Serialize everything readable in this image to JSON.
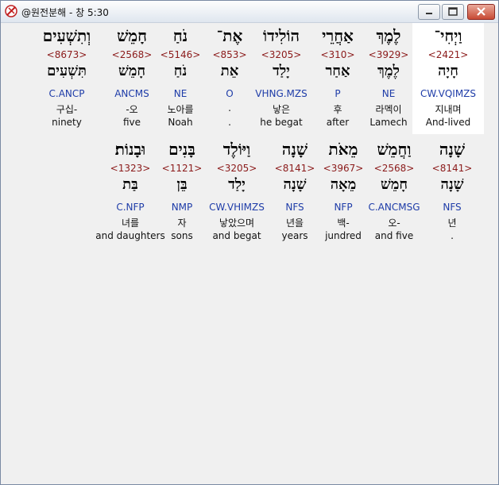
{
  "window": {
    "title": "@원전분해 - 창 5:30",
    "icon": "app-cross-icon"
  },
  "rows": [
    [
      {
        "heb": "וַיְחִי־",
        "strong": "<2421>",
        "lex": "חָיָה",
        "parse": "CW.VQIMZS",
        "kor": "지내며",
        "eng": "And-lived",
        "highlight": true
      },
      {
        "heb": "לֶמֶךְ",
        "strong": "<3929>",
        "lex": "לֶמֶךְ",
        "parse": "NE",
        "kor": "라멕이",
        "eng": "Lamech"
      },
      {
        "heb": "אַחֲרֵי",
        "strong": "<310>",
        "lex": "אַחַר",
        "parse": "P",
        "kor": "후",
        "eng": "after"
      },
      {
        "heb": "הוֹלִידוֹ",
        "strong": "<3205>",
        "lex": "יָלַד",
        "parse": "VHNG.MZS",
        "kor": "낳은",
        "eng": "he begat"
      },
      {
        "heb": "אֶת־",
        "strong": "<853>",
        "lex": "אֵת",
        "parse": "O",
        "kor": ".",
        "eng": "."
      },
      {
        "heb": "נֹחַ",
        "strong": "<5146>",
        "lex": "נֹחַ",
        "parse": "NE",
        "kor": "노아를",
        "eng": "Noah"
      },
      {
        "heb": "חָמֵשׁ",
        "strong": "<2568>",
        "lex": "חָמֵשׁ",
        "parse": "ANCMS",
        "kor": "-오",
        "eng": "five"
      },
      {
        "heb": "וְתִשְׁעִים",
        "strong": "<8673>",
        "lex": "תִּשְׁעִים",
        "parse": "C.ANCP",
        "kor": "구십-",
        "eng": "ninety"
      }
    ],
    [
      {
        "heb": "שָׁנָה",
        "strong": "<8141>",
        "lex": "שָׁנָה",
        "parse": "NFS",
        "kor": "년",
        "eng": "."
      },
      {
        "heb": "וַחֲמֵשׁ",
        "strong": "<2568>",
        "lex": "חָמֵשׁ",
        "parse": "C.ANCMSG",
        "kor": "오-",
        "eng": "and five"
      },
      {
        "heb": "מֵאֹת",
        "strong": "<3967>",
        "lex": "מֵאָה",
        "parse": "NFP",
        "kor": "백-",
        "eng": "jundred"
      },
      {
        "heb": "שָׁנָה",
        "strong": "<8141>",
        "lex": "שָׁנָה",
        "parse": "NFS",
        "kor": "년을",
        "eng": "years"
      },
      {
        "heb": "וַיּוֹלֶד",
        "strong": "<3205>",
        "lex": "יָלַד",
        "parse": "CW.VHIMZS",
        "kor": "낳았으며",
        "eng": "and begat"
      },
      {
        "heb": "בָּנִים",
        "strong": "<1121>",
        "lex": "בֵּן",
        "parse": "NMP",
        "kor": "자",
        "eng": "sons"
      },
      {
        "heb": "וּבָנוֹת׃",
        "strong": "<1323>",
        "lex": "בַּת",
        "parse": "C.NFP",
        "kor": "녀를",
        "eng": "and daughters"
      }
    ]
  ]
}
